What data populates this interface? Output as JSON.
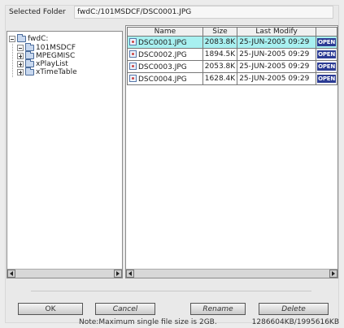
{
  "header": {
    "selected_folder_label": "Selected Folder",
    "selected_folder_path": "fwdC:/101MSDCF/DSC0001.JPG"
  },
  "tree": {
    "root": "fwdC:",
    "children": [
      "101MSDCF",
      "MPEGMISC",
      "xPlayList",
      "xTimeTable"
    ]
  },
  "files": {
    "columns": [
      "Name",
      "Size",
      "Last Modify",
      ""
    ],
    "rows": [
      {
        "name": "DSC0001.JPG",
        "size": "2083.8K",
        "date": "25-JUN-2005 09:29",
        "action": "OPEN"
      },
      {
        "name": "DSC0002.JPG",
        "size": "1894.5K",
        "date": "25-JUN-2005 09:29",
        "action": "OPEN"
      },
      {
        "name": "DSC0003.JPG",
        "size": "2053.8K",
        "date": "25-JUN-2005 09:29",
        "action": "OPEN"
      },
      {
        "name": "DSC0004.JPG",
        "size": "1628.4K",
        "date": "25-JUN-2005 09:29",
        "action": "OPEN"
      }
    ]
  },
  "buttons": {
    "ok": "OK",
    "cancel": "Cancel",
    "rename": "Rename",
    "delete": "Delete"
  },
  "footer": {
    "note": "Note:Maximum single file size is 2GB.",
    "space": "1286604KB/1995616KB"
  },
  "colors": {
    "selected_row": "#a8f0f0",
    "open_badge": "#2c3c94"
  }
}
